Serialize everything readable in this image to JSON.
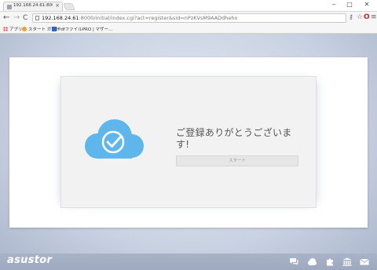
{
  "browser": {
    "tab_title": "192.168.24.61:8000/initial/",
    "tab_close": "×",
    "window_controls": {
      "minimize": "‒",
      "maximize": "□",
      "close": "✕"
    },
    "nav": {
      "back": "←",
      "forward": "→",
      "reload": "C"
    },
    "url_host": "192.168.24.61",
    "url_rest": ":8000/initial/index.cgi?act=register&sid=nPzKVsM9AADdheho",
    "toolbar_icons": {
      "key": "⚷",
      "star": "☆",
      "opera": "O",
      "menu": "≡"
    },
    "bookmarks": [
      "アプリ",
      "スタート ガイド",
      "PdfファイルPRO | マザー…"
    ]
  },
  "page": {
    "message": "ご登録ありがとうございます!",
    "start_button": "スタート",
    "icon_names": {
      "hero": "cloud-check-icon"
    }
  },
  "footer": {
    "logo": "asustor",
    "icons": [
      "chat-icon",
      "cloud-icon",
      "puzzle-icon",
      "bank-icon",
      "mail-icon"
    ]
  },
  "colors": {
    "cloud": "#5fb6ec",
    "page_bg": "#c9d2e2",
    "footer_bg": "#a3aec4"
  }
}
